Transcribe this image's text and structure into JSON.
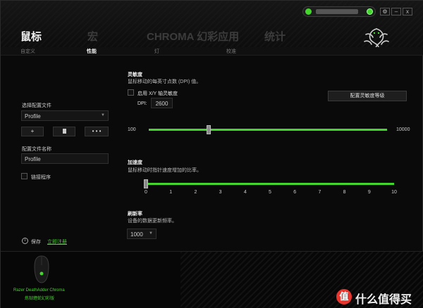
{
  "header": {
    "tabs": [
      {
        "label": "鼠标",
        "active": true
      },
      {
        "label": "宏",
        "active": false
      },
      {
        "label": "CHROMA 幻彩应用",
        "active": false
      },
      {
        "label": "统计",
        "active": false
      }
    ],
    "window_buttons": [
      "⚙",
      "–",
      "x"
    ]
  },
  "subtabs": [
    {
      "label": "自定义",
      "active": false
    },
    {
      "label": "性能",
      "active": true
    },
    {
      "label": "灯",
      "active": false
    },
    {
      "label": "校准",
      "active": false
    }
  ],
  "left": {
    "profile_label": "选择配置文件",
    "profile_value": "Profile",
    "buttons": [
      "+",
      "🗑",
      "• • •"
    ],
    "profile_name_label": "配置文件名称",
    "profile_name_value": "Profile",
    "link_program_label": "链接程序",
    "save_label": "保存",
    "save_icon": "info-icon",
    "register_label": "立即注册"
  },
  "sensitivity": {
    "title": "灵敏度",
    "desc": "鼠标移动的每英寸点数 (DPI) 值。",
    "xy_checkbox_label": "启用 X/Y 轴灵敏度",
    "dpi_label": "DPI:",
    "dpi_value": "2600",
    "config_button": "配置灵敏度等级",
    "min_label": "100",
    "max_label": "10000",
    "min": 100,
    "max": 10000,
    "value": 2600
  },
  "acceleration": {
    "title": "加速度",
    "desc": "鼠标移动时指针速度增加的比率。",
    "ticks": [
      "0",
      "1",
      "2",
      "3",
      "4",
      "5",
      "6",
      "7",
      "8",
      "9",
      "10"
    ],
    "value": 0
  },
  "polling": {
    "title": "刷新率",
    "desc": "设备的数据更新频率。",
    "value": "1000",
    "arrow": "▼"
  },
  "device": {
    "name": "Razer DeathAdder Chroma",
    "subname": "炼狱蝰蛇幻彩版"
  },
  "watermark": {
    "icon_text": "值",
    "text": "什么值得买"
  },
  "colors": {
    "accent": "#44d62c",
    "background": "#0a0a0a"
  }
}
